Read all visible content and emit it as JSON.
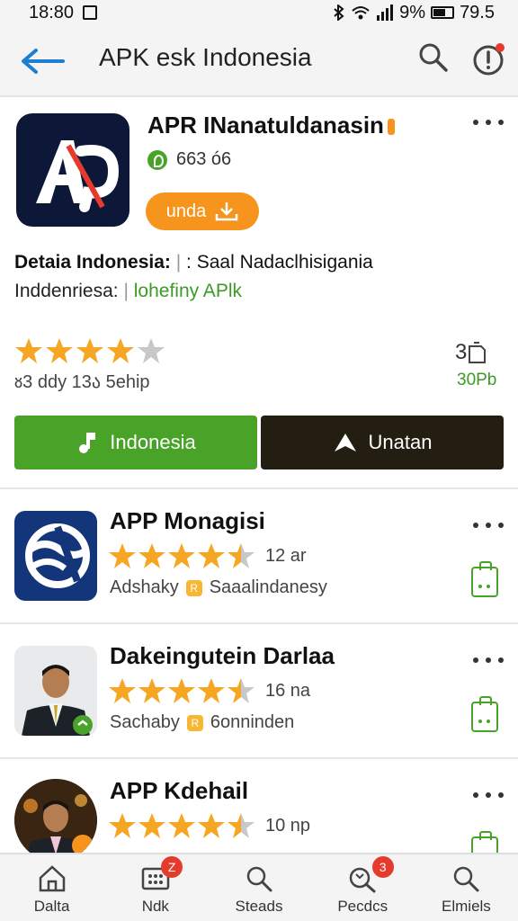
{
  "status_bar": {
    "time": "18:80",
    "battery": "9%",
    "extra": "79.5"
  },
  "app_bar": {
    "title": "APK esk Indonesia"
  },
  "hero": {
    "app_name": "APR INanatuldanasin",
    "version": "663 ó6",
    "update_label": "unda",
    "detail_line1_label": "Detaia Indonesia:",
    "detail_line1_value": ": Saal Nadaclhisigania",
    "detail_line2_label": "Inddenriesa:",
    "detail_line2_link": "lohefiny APlk",
    "rating": 4,
    "rating_text": "ᴕ3 ddy 13ა 5ehip",
    "size_value": "3",
    "size_label": "30Pb",
    "install_label": "Indonesia",
    "share_label": "Unatan"
  },
  "list": [
    {
      "title": "APP Monagisi",
      "rating": 4.5,
      "count": "12 ar",
      "author": "Adshaky",
      "category": "Saaalindanesy"
    },
    {
      "title": "Dakeingutein Darlaa",
      "rating": 4.5,
      "count": "16 na",
      "author": "Sachaby",
      "category": "6onninden"
    },
    {
      "title": "APP Kdehail",
      "rating": 4.5,
      "count": "10 np",
      "author": "",
      "category": ""
    }
  ],
  "bottom_nav": [
    {
      "label": "Dalta",
      "icon": "home-icon",
      "badge": ""
    },
    {
      "label": "Ndk",
      "icon": "grid-icon",
      "badge": "Z"
    },
    {
      "label": "Steads",
      "icon": "search-icon",
      "badge": ""
    },
    {
      "label": "Pecdcs",
      "icon": "search-icon",
      "badge": "3"
    },
    {
      "label": "Elmiels",
      "icon": "search-icon",
      "badge": ""
    }
  ],
  "colors": {
    "accent_green": "#4aa329",
    "accent_orange": "#f7941d",
    "star": "#f5a623",
    "primary_blue": "#1e7fd0",
    "dark_button": "#241d12"
  }
}
